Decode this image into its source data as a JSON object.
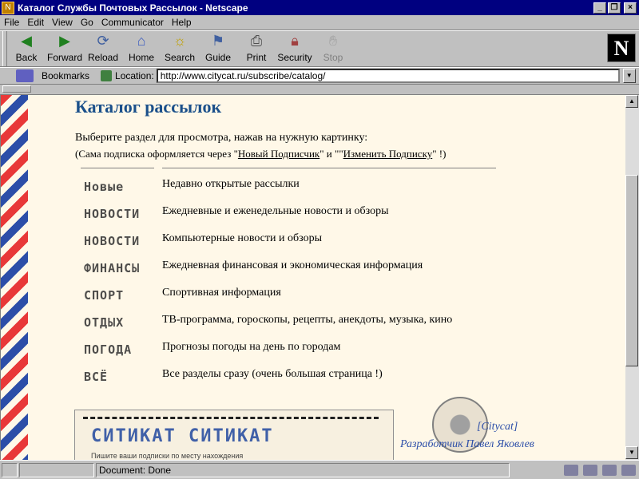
{
  "window": {
    "title": "Каталог Службы Почтовых Рассылок - Netscape"
  },
  "menu": [
    "File",
    "Edit",
    "View",
    "Go",
    "Communicator",
    "Help"
  ],
  "toolbar": [
    {
      "label": "Back",
      "icon": "back-icon"
    },
    {
      "label": "Forward",
      "icon": "forward-icon"
    },
    {
      "label": "Reload",
      "icon": "reload-icon"
    },
    {
      "label": "Home",
      "icon": "home-icon"
    },
    {
      "label": "Search",
      "icon": "search-icon"
    },
    {
      "label": "Guide",
      "icon": "guide-icon"
    },
    {
      "label": "Print",
      "icon": "print-icon"
    },
    {
      "label": "Security",
      "icon": "security-icon"
    },
    {
      "label": "Stop",
      "icon": "stop-icon"
    }
  ],
  "location": {
    "bookmarks_label": "Bookmarks",
    "location_label": "Location:",
    "url": "http://www.citycat.ru/subscribe/catalog/"
  },
  "page": {
    "heading": "Каталог рассылок",
    "intro": "Выберите раздел для просмотра, нажав на нужную картинку:",
    "note_prefix": "(Сама подписка оформляется через \"",
    "note_link1": "Новый Подписчик",
    "note_mid": "\" и \"\"",
    "note_link2": "Изменить Подписку",
    "note_suffix": "\" !)",
    "rows": [
      {
        "stamp": "Новые",
        "desc": "Недавно открытые рассылки"
      },
      {
        "stamp": "НОВОСТИ",
        "desc": "Ежедневные и еженедельные новости и обзоры"
      },
      {
        "stamp": "НОВОСТИ",
        "desc": "Компьютерные новости и обзоры"
      },
      {
        "stamp": "ФИНАНСЫ",
        "desc": "Ежедневная финансовая и экономическая информация"
      },
      {
        "stamp": "СПОРТ",
        "desc": "Спортивная информация"
      },
      {
        "stamp": "ОТДЫХ",
        "desc": "ТВ-программа, гороскопы, рецепты, анекдоты, музыка, кино"
      },
      {
        "stamp": "ПОГОДА",
        "desc": "Прогнозы погоды на день по городам"
      },
      {
        "stamp": "ВСЁ",
        "desc": "Все разделы сразу (очень большая страница !)"
      }
    ],
    "footer_stamp_text": "СИТИКАТ СИТИКАТ",
    "footer_small": "Пишите ваши подписки по месту нахождения",
    "citycat": "[Citycat]",
    "author": "Разработчик Павел Яковлев"
  },
  "status": {
    "text": "Document: Done"
  },
  "colors": {
    "title_bar": "#000080",
    "heading": "#1a4f8a",
    "page_bg": "#fff8e8",
    "stripe_red": "#e83838",
    "stripe_blue": "#2c4ea8"
  }
}
